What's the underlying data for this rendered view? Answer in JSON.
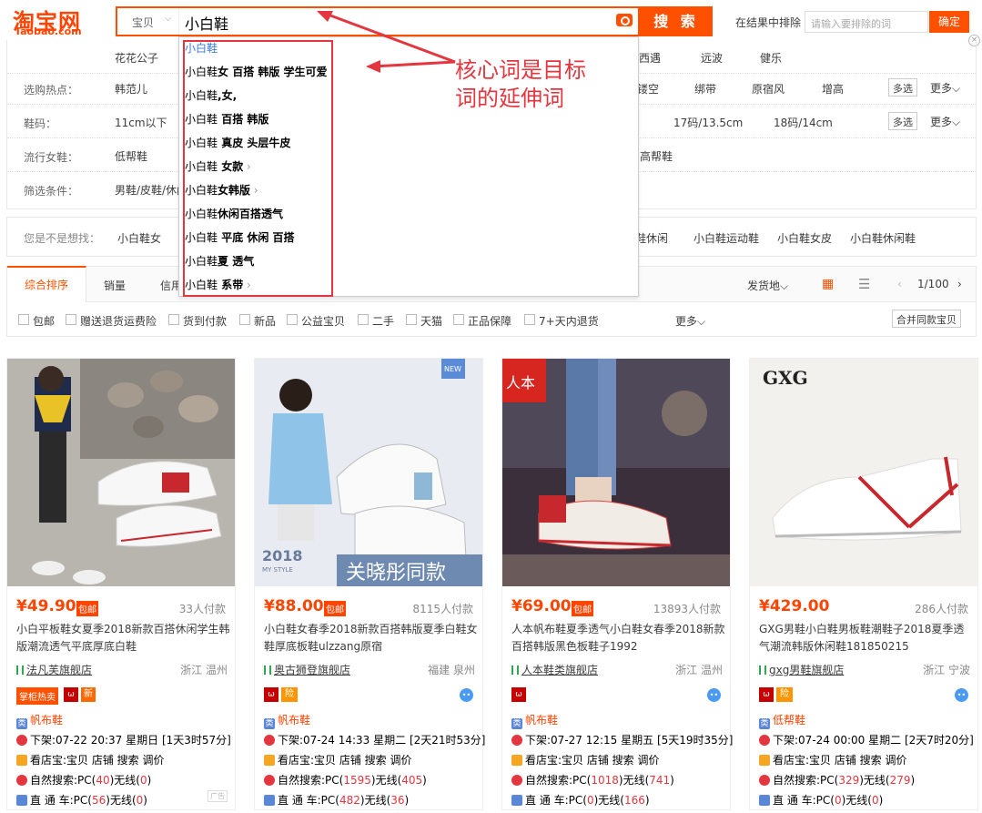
{
  "header": {
    "logo_cn": "淘宝网",
    "logo_en": "Taobao.com",
    "search_category": "宝贝",
    "search_query": "小白鞋",
    "search_button": "搜 索",
    "exclude_label": "在结果中排除",
    "exclude_placeholder": "请输入要排除的词",
    "exclude_button": "确定"
  },
  "dropdown": {
    "items": [
      {
        "base": "小白鞋",
        "ext": ""
      },
      {
        "base": "小白鞋",
        "ext": "女 百搭 韩版 学生可爱"
      },
      {
        "base": "小白鞋",
        "ext": ",女,"
      },
      {
        "base": "小白鞋",
        "ext": " 百搭 韩版"
      },
      {
        "base": "小白鞋",
        "ext": " 真皮 头层牛皮"
      },
      {
        "base": "小白鞋",
        "ext": " 女款"
      },
      {
        "base": "小白鞋",
        "ext": "女韩版"
      },
      {
        "base": "小白鞋",
        "ext": "休闲百搭透气"
      },
      {
        "base": "小白鞋",
        "ext": " 平底 休闲 百搭"
      },
      {
        "base": "小白鞋",
        "ext": "夏 透气"
      },
      {
        "base": "小白鞋",
        "ext": " 系带"
      }
    ],
    "annotation_line1": "核心词是目标",
    "annotation_line2": "词的延伸词"
  },
  "filters": {
    "row0": {
      "items": [
        "花花公子",
        "/西遇",
        "远波",
        "健乐"
      ]
    },
    "row1": {
      "label": "选购热点：",
      "items": [
        "韩范儿",
        "镂空",
        "绑带",
        "原宿风",
        "增高"
      ],
      "multi": "多选",
      "more": "更多"
    },
    "row2": {
      "label": "鞋码：",
      "items": [
        "11cm以下",
        "17码/13.5cm",
        "18码/14cm"
      ],
      "multi": "多选",
      "more": "更多"
    },
    "row3": {
      "label": "流行女鞋：",
      "items": [
        "低帮鞋",
        "高帮鞋"
      ]
    },
    "row4": {
      "label": "筛选条件：",
      "items": [
        "男鞋/皮鞋/休闲"
      ]
    }
  },
  "suggest": {
    "label": "您是不是想找：",
    "items": [
      "小白鞋女",
      "鞋休闲",
      "小白鞋运动鞋",
      "小白鞋女皮",
      "小白鞋休闲鞋"
    ]
  },
  "sortbar": {
    "active": "综合排序",
    "items": [
      "销量",
      "信用"
    ],
    "ship_from": "发货地",
    "page": "1/100"
  },
  "options": {
    "items": [
      "包邮",
      "赠送退货运费险",
      "货到付款",
      "新品",
      "公益宝贝",
      "二手",
      "天猫",
      "正品保障",
      "7+天内退货"
    ],
    "more": "更多",
    "merge": "合并同款宝贝"
  },
  "products": [
    {
      "price": "¥49.90",
      "bao": "包邮",
      "paid": "33人付款",
      "title_parts": [
        "小白平板鞋女夏季2018新款百搭休闲学生韩版潮流透气平底厚底白鞋"
      ],
      "shop": "法凡芙旗舰店",
      "loc": "浙江 温州",
      "hot": "掌柜热卖",
      "newb": "新",
      "category": "帆布鞋",
      "shelf": "下架:07-22 20:37 星期日 [1天3时57分]",
      "store_rank": "看店宝:宝贝 店铺 搜索 调价",
      "natural_pc": "40",
      "natural_mobile": "0",
      "direct_pc": "56",
      "direct_mobile": "0",
      "ad": "广告"
    },
    {
      "price": "¥88.00",
      "bao": "包邮",
      "paid": "8115人付款",
      "title_parts": [
        "小白鞋女春季2018新款百搭韩版夏季白鞋女鞋厚底板鞋ulzzang原宿"
      ],
      "shop": "奥古狮登旗舰店",
      "loc": "福建 泉州",
      "yellow": "险",
      "category": "帆布鞋",
      "shelf": "下架:07-24 14:33 星期二 [2天21时53分]",
      "store_rank": "看店宝:宝贝 店铺 搜索 调价",
      "natural_pc": "1595",
      "natural_mobile": "405",
      "direct_pc": "482",
      "direct_mobile": "36",
      "img_new": "NEW",
      "img_year": "2018",
      "img_style": "MY STYLE",
      "img_caption": "关晓彤同款"
    },
    {
      "price": "¥69.00",
      "bao": "包邮",
      "paid": "13893人付款",
      "title_parts": [
        "人本帆布鞋夏季透气小白鞋女春季2018新款百搭韩版黑色板鞋子1992"
      ],
      "shop": "人本鞋类旗舰店",
      "loc": "浙江 温州",
      "category": "帆布鞋",
      "shelf": "下架:07-27 12:15 星期五 [5天19时35分]",
      "store_rank": "看店宝:宝贝 店铺 搜索 调价",
      "natural_pc": "1018",
      "natural_mobile": "741",
      "direct_pc": "0",
      "direct_mobile": "166",
      "img_logo": "人本"
    },
    {
      "price": "¥429.00",
      "paid": "286人付款",
      "title_parts": [
        "GXG男鞋小白鞋男板鞋潮鞋子2018夏季透气潮流韩版休闲鞋181850215"
      ],
      "shop": "gxg男鞋旗舰店",
      "loc": "浙江 宁波",
      "yellow": "险",
      "category": "低帮鞋",
      "shelf": "下架:07-24 00:00 星期二 [2天7时20分]",
      "store_rank": "看店宝:宝贝 店铺 搜索 调价",
      "natural_pc": "329",
      "natural_mobile": "279",
      "direct_pc": "0",
      "direct_mobile": "0",
      "img_logo": "GXG"
    }
  ],
  "labels": {
    "natural": "自然搜索:PC(",
    "mobile": ")无线(",
    "close": ")",
    "direct": "直 通 车:PC("
  },
  "colors": {
    "accent": "#ff5000",
    "price": "#ff4400",
    "annotation": "#e3363f"
  }
}
